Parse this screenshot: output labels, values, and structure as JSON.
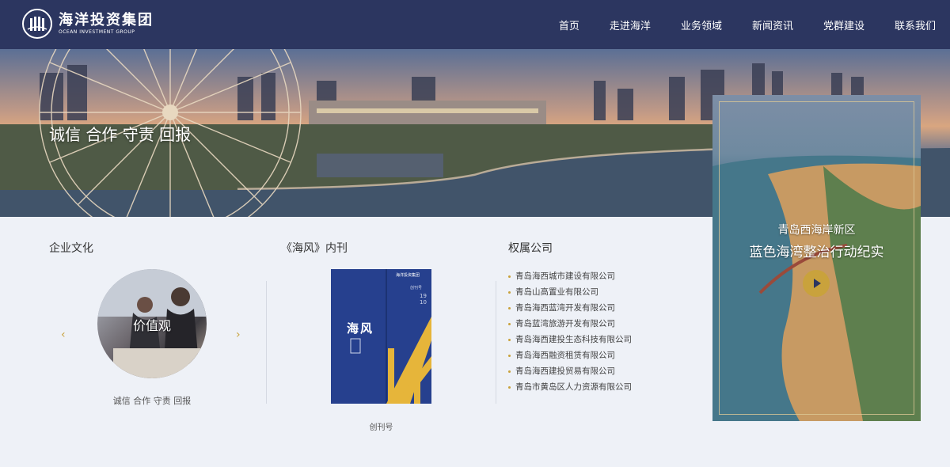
{
  "header": {
    "logo_cn": "海洋投资集团",
    "logo_en": "OCEAN INVESTMENT GROUP",
    "nav": [
      "首页",
      "走进海洋",
      "业务领域",
      "新闻资讯",
      "党群建设",
      "联系我们"
    ]
  },
  "banner": {
    "slogan": "诚信 合作 守责 回报"
  },
  "culture": {
    "title": "企业文化",
    "circle_label": "价值观",
    "caption": "诚信  合作  守责  回报",
    "prev_icon": "chevron-left-icon",
    "next_icon": "chevron-right-icon"
  },
  "magazine": {
    "title": "《海风》内刊",
    "cover_title": "海风",
    "cover_logo": "海洋投资集团",
    "cover_issue_top": "创刊号",
    "cover_year": "19",
    "cover_num": "10",
    "caption": "创刊号"
  },
  "companies": {
    "title": "权属公司",
    "items": [
      "青岛海西城市建设有限公司",
      "青岛山高置业有限公司",
      "青岛海西蓝湾开发有限公司",
      "青岛蓝湾旅游开发有限公司",
      "青岛海西建投生态科技有限公司",
      "青岛海西融资租赁有限公司",
      "青岛海西建投贸易有限公司",
      "青岛市黄岛区人力资源有限公司"
    ]
  },
  "feature": {
    "subtitle": "青岛西海岸新区",
    "title": "蓝色海湾整治行动纪实",
    "play_icon": "play-icon"
  },
  "colors": {
    "header_bg": "#2c3660",
    "accent_gold": "#c9a23c",
    "page_bg": "#eef1f7"
  }
}
